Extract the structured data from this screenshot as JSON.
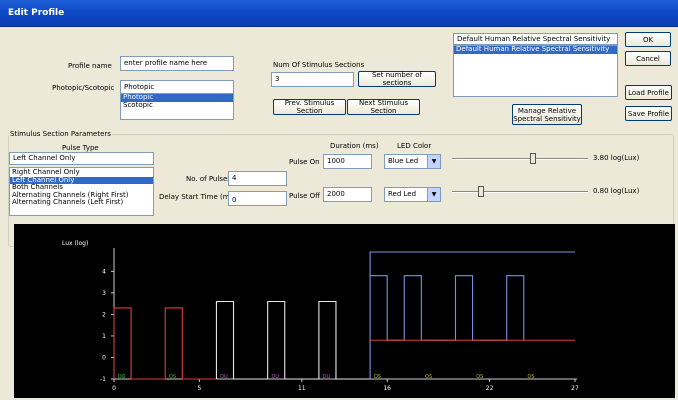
{
  "window": {
    "title": "Edit Profile"
  },
  "profile": {
    "name_label": "Profile name",
    "name_value": "enter profile name here",
    "mode_label": "Photopic/Scotopic",
    "mode_value": "Photopic",
    "mode_options": [
      "Photopic",
      "Scotopic"
    ]
  },
  "sections": {
    "num_label": "Num Of Stimulus Sections",
    "num_value": "3",
    "set_button": "Set number of sections",
    "prev_button": "Prev. Stimulus Section",
    "next_button": "Next Stimulus Section"
  },
  "sensitivity": {
    "value": "Default Human Relative Spectral Sensitivity",
    "items": [
      "Default Human Relative Spectral Sensitivity"
    ],
    "manage_button": "Manage Relative Spectral Sensitivity"
  },
  "buttons": {
    "ok": "OK",
    "cancel": "Cancel",
    "load": "Load Profile",
    "save": "Save  Profile"
  },
  "stimulus": {
    "group_label": "Stimulus Section Parameters",
    "pulse_type_label": "Pulse Type",
    "pulse_type_value": "Left Channel Only",
    "pulse_type_options": [
      "Right Channel Only",
      "Left Channel Only",
      "Both Channels",
      "Alternating Channels (Right First)",
      "Alternating Channels (Left First)"
    ],
    "selected_index": 1,
    "num_pulses_label": "No. of Pulses",
    "num_pulses_value": "4",
    "delay_label": "Delay Start Time (ms)",
    "delay_value": "0",
    "duration_label": "Duration (ms)",
    "led_color_label": "LED Color",
    "pulse_on_label": "Pulse On",
    "pulse_on_value": "1000",
    "pulse_on_led": "Blue Led",
    "pulse_off_label": "Pulse Off",
    "pulse_off_value": "2000",
    "pulse_off_led": "Red Led",
    "on_intensity": "3.80 log(Lux)",
    "off_intensity": "0.80 log(Lux)",
    "on_level": 0.6,
    "off_level": 0.2
  },
  "chart_data": {
    "type": "line",
    "ylabel": "Lux (log)",
    "x_ticks": [
      0,
      5,
      11,
      16,
      22,
      27
    ],
    "y_ticks": [
      -1,
      0,
      1,
      2,
      3,
      4
    ],
    "xlim": [
      0,
      27
    ],
    "ylim": [
      -1,
      4.9
    ],
    "colors": {
      "red": "#d94040",
      "white": "#e6e6e6",
      "purple": "#c06ad0",
      "blue": "#7f8fe0",
      "green": "#3fbf3f",
      "olive": "#b8b820",
      "label_purple": "#b060c0"
    },
    "series": [
      {
        "values": [
          [
            0,
            -1
          ],
          [
            0,
            2.3
          ],
          [
            1,
            2.3
          ],
          [
            1,
            -1
          ],
          [
            3,
            -1
          ],
          [
            3,
            2.3
          ],
          [
            4,
            2.3
          ],
          [
            4,
            -1
          ],
          [
            6,
            -1
          ]
        ],
        "color": "red"
      },
      {
        "values": [
          [
            6,
            -1
          ],
          [
            6,
            2.6
          ],
          [
            7,
            2.6
          ],
          [
            7,
            -1
          ],
          [
            9,
            -1
          ],
          [
            9,
            2.6
          ],
          [
            10,
            2.6
          ],
          [
            10,
            -1
          ],
          [
            12,
            -1
          ],
          [
            12,
            2.6
          ],
          [
            13,
            2.6
          ],
          [
            13,
            -1
          ],
          [
            15,
            -1
          ]
        ],
        "color": "white"
      },
      {
        "values": [
          [
            15,
            -1
          ],
          [
            15,
            4.9
          ],
          [
            27,
            4.9
          ]
        ],
        "color": "blue"
      },
      {
        "values": [
          [
            15,
            3.8
          ],
          [
            16,
            3.8
          ],
          [
            16,
            0.8
          ],
          [
            17,
            0.8
          ],
          [
            17,
            3.8
          ],
          [
            18,
            3.8
          ],
          [
            18,
            0.8
          ],
          [
            20,
            0.8
          ],
          [
            20,
            3.8
          ],
          [
            21,
            3.8
          ],
          [
            21,
            0.8
          ],
          [
            23,
            0.8
          ],
          [
            23,
            3.8
          ],
          [
            24,
            3.8
          ],
          [
            24,
            0.8
          ]
        ],
        "color": "blue"
      },
      {
        "values": [
          [
            15,
            0.8
          ],
          [
            27,
            0.8
          ]
        ],
        "color": "red"
      }
    ],
    "annotations": [
      {
        "x": 0.1,
        "text": "DO",
        "color": "green"
      },
      {
        "x": 3.1,
        "text": "OS",
        "color": "green"
      },
      {
        "x": 6.1,
        "text": "DU",
        "color": "label_purple"
      },
      {
        "x": 9.1,
        "text": "DU",
        "color": "label_purple"
      },
      {
        "x": 12.1,
        "text": "DU",
        "color": "label_purple"
      },
      {
        "x": 15.1,
        "text": "OS",
        "color": "olive"
      },
      {
        "x": 18.1,
        "text": "OS",
        "color": "olive"
      },
      {
        "x": 21.1,
        "text": "OS",
        "color": "olive"
      },
      {
        "x": 24.1,
        "text": "OS",
        "color": "olive"
      }
    ]
  }
}
